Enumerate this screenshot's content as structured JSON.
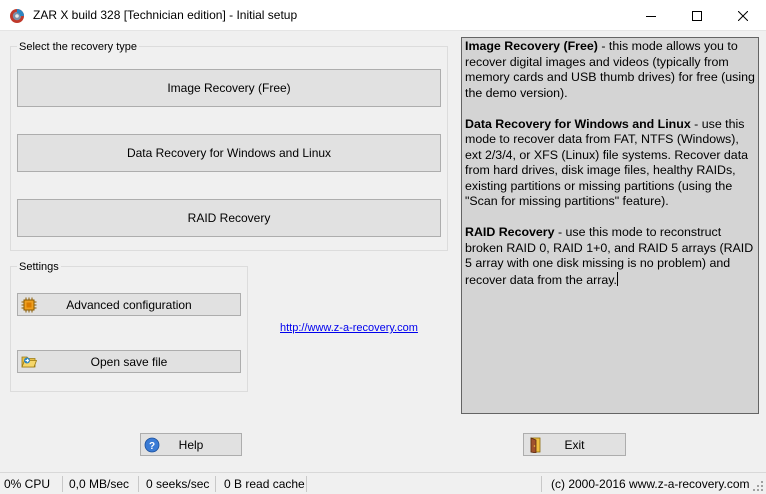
{
  "window": {
    "title": "ZAR X build 328 [Technician edition] - Initial setup",
    "icon": "zar-app-icon",
    "controls": {
      "minimize": "minimize-icon",
      "maximize": "maximize-icon",
      "close": "close-icon"
    }
  },
  "recovery_group": {
    "legend": "Select the recovery type",
    "buttons": [
      {
        "label": "Image Recovery (Free)"
      },
      {
        "label": "Data Recovery for Windows and Linux"
      },
      {
        "label": "RAID Recovery"
      }
    ]
  },
  "settings_group": {
    "legend": "Settings",
    "advanced_label": "Advanced configuration",
    "open_label": "Open save file"
  },
  "link": "http://www.z-a-recovery.com",
  "info": {
    "image_title": "Image Recovery (Free)",
    "image_text": " - this mode allows you to recover digital images and videos (typically from memory cards and USB thumb drives) for free (using the demo version).",
    "data_title": "Data Recovery for Windows and Linux",
    "data_text": " - use this mode to recover data from FAT, NTFS (Windows), ext 2/3/4, or XFS (Linux) file systems. Recover data from hard drives, disk image files, healthy RAIDs, existing partitions or missing partitions (using the \"Scan for missing partitions\" feature).",
    "raid_title": "RAID Recovery",
    "raid_text": " - use this mode to reconstruct broken RAID 0, RAID 1+0, and RAID 5 arrays (RAID 5 array with one disk missing is no problem) and recover data from the array."
  },
  "footer": {
    "help_label": "Help",
    "exit_label": "Exit"
  },
  "status": {
    "cpu": "0% CPU",
    "speed": "0,0 MB/sec",
    "seeks": "0 seeks/sec",
    "cache": "0 B read cache",
    "copyright": "(c) 2000-2016 www.z-a-recovery.com"
  },
  "colors": {
    "button_face": "#e1e1e1",
    "button_border": "#adadad",
    "link": "#0000ee",
    "info_bg": "#d4d4d4",
    "window_bg": "#f0f0f0"
  }
}
